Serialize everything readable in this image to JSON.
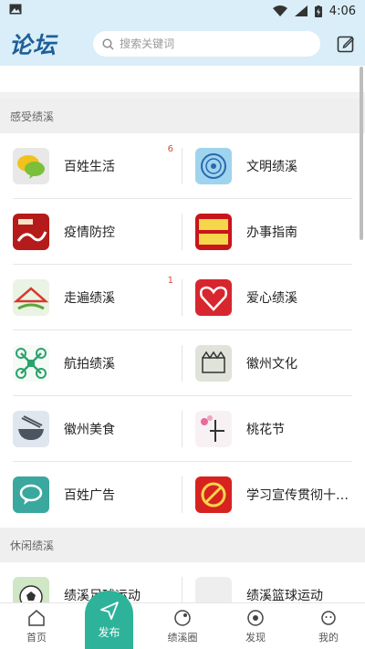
{
  "status_bar": {
    "time": "4:06"
  },
  "header": {
    "logo": "论坛",
    "search_placeholder": "搜索关键词"
  },
  "sections": [
    {
      "title": "感受绩溪",
      "items": [
        {
          "label": "百姓生活",
          "badge": "6",
          "icon": "speech-bubbles-icon"
        },
        {
          "label": "文明绩溪",
          "badge": "",
          "icon": "civilization-emblem-icon"
        },
        {
          "label": "疫情防控",
          "badge": "",
          "icon": "epidemic-poster-icon"
        },
        {
          "label": "办事指南",
          "badge": "",
          "icon": "service-guide-icon"
        },
        {
          "label": "走遍绩溪",
          "badge": "1",
          "icon": "travel-house-icon"
        },
        {
          "label": "爱心绩溪",
          "badge": "",
          "icon": "heart-icon"
        },
        {
          "label": "航拍绩溪",
          "badge": "",
          "icon": "drone-icon"
        },
        {
          "label": "徽州文化",
          "badge": "",
          "icon": "huizhou-culture-icon"
        },
        {
          "label": "徽州美食",
          "badge": "",
          "icon": "food-bowl-icon"
        },
        {
          "label": "桃花节",
          "badge": "",
          "icon": "peach-blossom-icon"
        },
        {
          "label": "百姓广告",
          "badge": "",
          "icon": "ad-bubble-icon"
        },
        {
          "label": "学习宣传贯彻十九大",
          "badge": "",
          "icon": "party-emblem-icon"
        }
      ]
    },
    {
      "title": "休闲绩溪",
      "items": [
        {
          "label": "绩溪足球运动",
          "badge": "",
          "icon": "football-icon"
        },
        {
          "label": "绩溪篮球运动",
          "badge": "",
          "icon": "basketball-placeholder-icon"
        }
      ]
    }
  ],
  "bottom_nav": [
    {
      "label": "首页",
      "icon": "home-icon"
    },
    {
      "label": "发布",
      "icon": "send-icon"
    },
    {
      "label": "绩溪圈",
      "icon": "circle-icon"
    },
    {
      "label": "发现",
      "icon": "discover-icon"
    },
    {
      "label": "我的",
      "icon": "profile-icon"
    }
  ],
  "colors": {
    "header_bg": "#d9eef8",
    "accent": "#2eb39a",
    "logo": "#1f5f98",
    "badge": "#e2453c"
  }
}
